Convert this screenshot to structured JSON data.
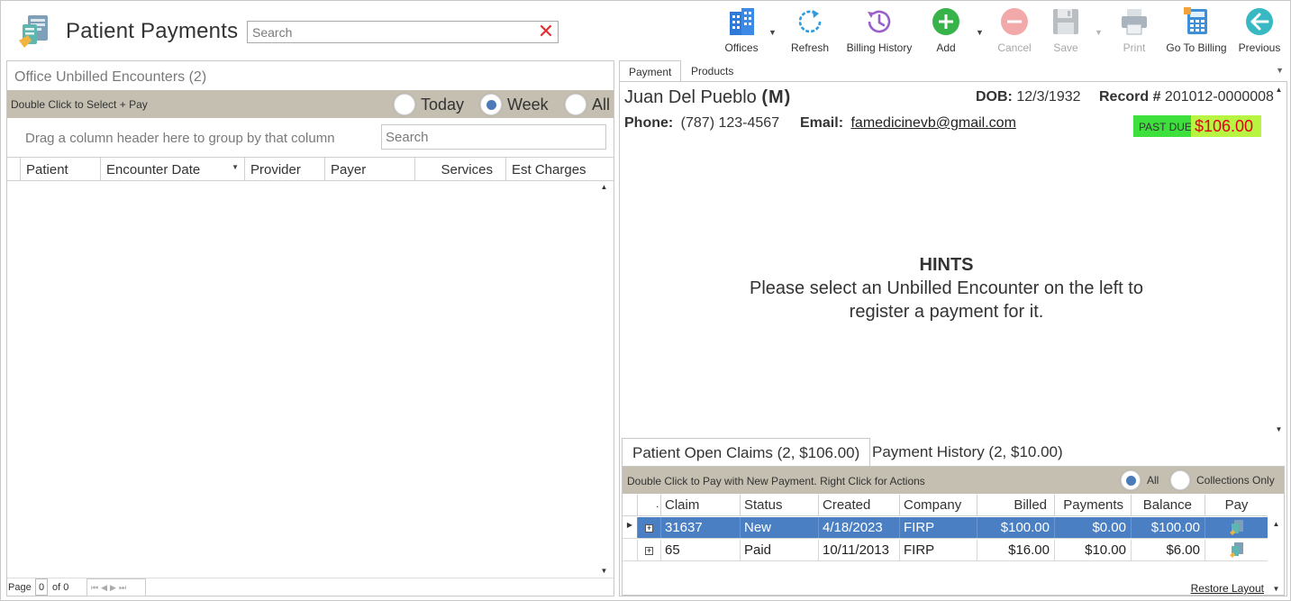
{
  "app": {
    "title": "Patient Payments",
    "search_placeholder": "Search"
  },
  "toolbar": {
    "offices": "Offices",
    "refresh": "Refresh",
    "billing_history": "Billing History",
    "add": "Add",
    "cancel": "Cancel",
    "save": "Save",
    "print": "Print",
    "go_to_billing": "Go To Billing",
    "previous": "Previous"
  },
  "left": {
    "title": "Office Unbilled Encounters (2)",
    "bar_text": "Double Click to Select + Pay",
    "filters": [
      {
        "label": "Today",
        "selected": false
      },
      {
        "label": "Week",
        "selected": true
      },
      {
        "label": "All",
        "selected": false
      }
    ],
    "group_hint": "Drag a column header here to group by that column",
    "search_placeholder": "Search",
    "columns": [
      "Patient",
      "Encounter Date",
      "Provider",
      "Payer",
      "Services",
      "Est Charges"
    ],
    "pager": {
      "page_label": "Page",
      "page": "0",
      "of_label": "of 0"
    }
  },
  "right": {
    "tabs": [
      "Payment",
      "Products"
    ],
    "patient": {
      "name": "Juan Del Pueblo",
      "sex": "(M)",
      "dob_label": "DOB:",
      "dob": "12/3/1932",
      "record_label": "Record #",
      "record": "201012-0000008",
      "phone_label": "Phone:",
      "phone": "(787) 123-4567",
      "email_label": "Email:",
      "email": "famedicinevb@gmail.com",
      "past_due_label": "PAST DUE",
      "past_due_amount": "$106.00"
    },
    "hints": {
      "title": "HINTS",
      "line1": "Please select an Unbilled Encounter on the left to",
      "line2": "register a payment for it."
    },
    "claims_tabs": [
      "Patient Open Claims (2, $106.00)",
      "Payment History (2, $10.00)"
    ],
    "claims_bar_text": "Double Click to Pay with New Payment. Right Click for Actions",
    "claims_filters": [
      {
        "label": "All",
        "selected": true
      },
      {
        "label": "Collections Only",
        "selected": false
      }
    ],
    "claims_columns": [
      ".",
      "Claim",
      "Status",
      "Created",
      "Company",
      "Billed",
      "Payments",
      "Balance",
      "Pay"
    ],
    "claims": [
      {
        "claim": "31637",
        "status": "New",
        "created": "4/18/2023",
        "company": "FIRP",
        "billed": "$100.00",
        "payments": "$0.00",
        "balance": "$100.00",
        "selected": true
      },
      {
        "claim": "65",
        "status": "Paid",
        "created": "10/11/2013",
        "company": "FIRP",
        "billed": "$16.00",
        "payments": "$10.00",
        "balance": "$6.00",
        "selected": false
      }
    ],
    "restore_layout": "Restore Layout"
  },
  "colors": {
    "bar_bg": "#c4bfb1",
    "selected_row": "#4a80c3",
    "radio_on": "#4a7ab7",
    "past_due_bg": "#3ee03e",
    "past_due_amount_bg": "#b7f542",
    "past_due_text": "#e3001b"
  }
}
